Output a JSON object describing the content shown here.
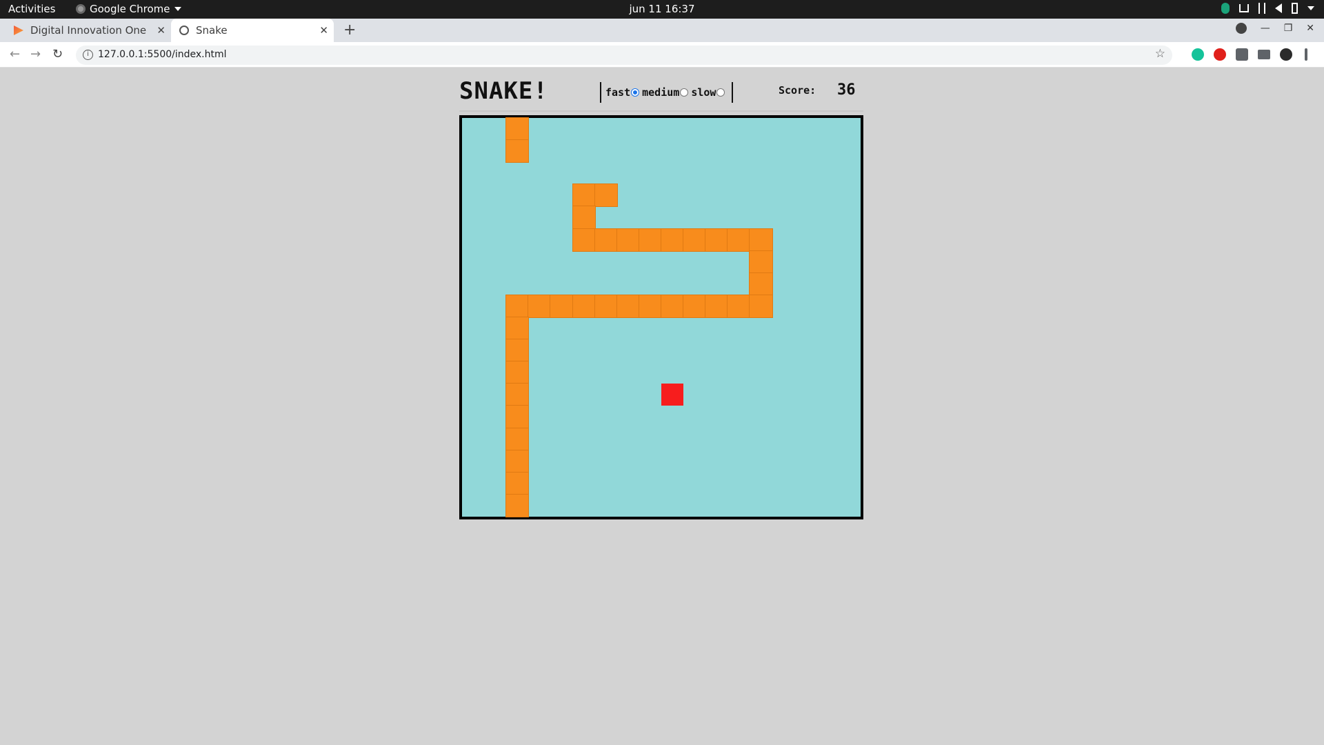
{
  "system_bar": {
    "activities": "Activities",
    "app_name": "Google Chrome",
    "clock": "jun 11  16:37"
  },
  "browser": {
    "tabs": [
      {
        "title": "Digital Innovation One",
        "active": false
      },
      {
        "title": "Snake",
        "active": true
      }
    ],
    "url": "127.0.0.1:5500/index.html"
  },
  "game": {
    "title": "SNAKE!",
    "speed_options": [
      {
        "label": "fast",
        "selected": true
      },
      {
        "label": "medium",
        "selected": false
      },
      {
        "label": "slow",
        "selected": false
      }
    ],
    "score_label": "Score:",
    "score": "36",
    "colors": {
      "board": "#91d8d9",
      "snake": "#f88c1c",
      "food": "#f71d1d"
    },
    "grid_cells": 18,
    "snake_segments": [
      [
        2,
        0
      ],
      [
        2,
        1
      ],
      [
        5,
        3
      ],
      [
        6,
        3
      ],
      [
        5,
        4
      ],
      [
        5,
        5
      ],
      [
        6,
        5
      ],
      [
        7,
        5
      ],
      [
        8,
        5
      ],
      [
        9,
        5
      ],
      [
        10,
        5
      ],
      [
        11,
        5
      ],
      [
        12,
        5
      ],
      [
        13,
        5
      ],
      [
        13,
        6
      ],
      [
        13,
        7
      ],
      [
        2,
        8
      ],
      [
        3,
        8
      ],
      [
        4,
        8
      ],
      [
        5,
        8
      ],
      [
        6,
        8
      ],
      [
        7,
        8
      ],
      [
        8,
        8
      ],
      [
        9,
        8
      ],
      [
        10,
        8
      ],
      [
        11,
        8
      ],
      [
        12,
        8
      ],
      [
        13,
        8
      ],
      [
        2,
        9
      ],
      [
        2,
        10
      ],
      [
        2,
        11
      ],
      [
        2,
        12
      ],
      [
        2,
        13
      ],
      [
        2,
        14
      ],
      [
        2,
        15
      ],
      [
        2,
        16
      ],
      [
        2,
        17
      ]
    ],
    "food": [
      9,
      12
    ]
  }
}
